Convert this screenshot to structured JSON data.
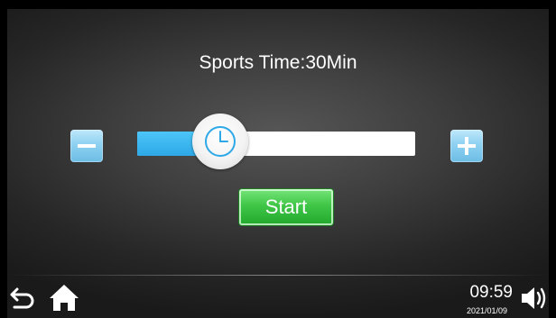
{
  "header": {
    "title": "Sports Time:30Min"
  },
  "timer_slider": {
    "value_fraction": 0.3,
    "minus_icon": "minus-icon",
    "plus_icon": "plus-icon",
    "knob_icon": "clock-icon",
    "fill_color": "#2ea8e6",
    "track_color": "#ffffff"
  },
  "actions": {
    "start_label": "Start",
    "start_color": "#3fc647"
  },
  "footer": {
    "back_icon": "back-arrow-icon",
    "home_icon": "home-icon",
    "time": "09:59",
    "date": "2021/01/09",
    "volume_icon": "volume-icon"
  }
}
